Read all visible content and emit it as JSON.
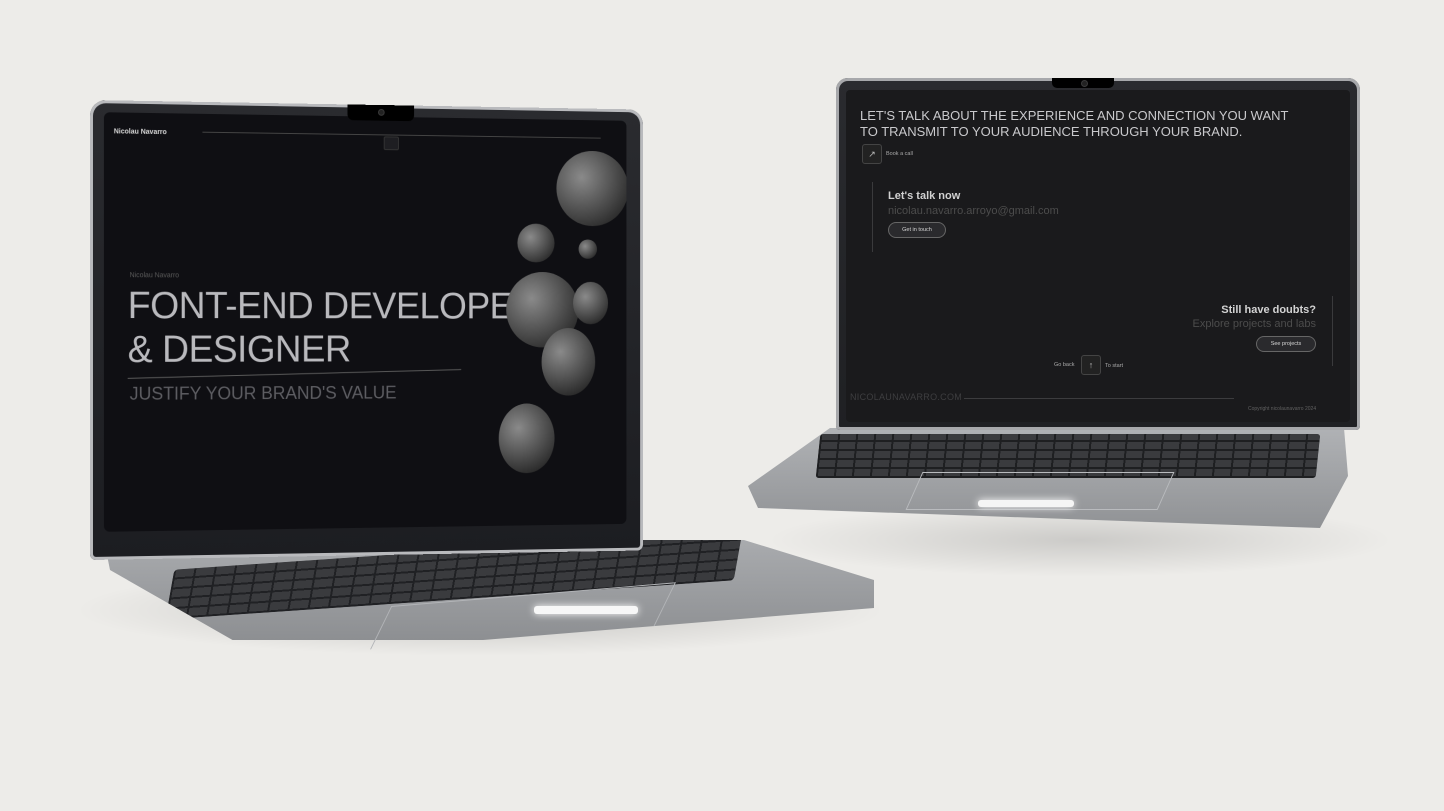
{
  "left_screen": {
    "nav": {
      "brand": "Nicolau Navarro"
    },
    "hero": {
      "eyebrow": "Nicolau Navarro",
      "title": "FONT-END DEVELOPER\n& DESIGNER",
      "subtitle": "JUSTIFY YOUR BRAND'S VALUE"
    }
  },
  "right_screen": {
    "cta": {
      "heading": "LET'S TALK ABOUT THE EXPERIENCE AND CONNECTION YOU WANT TO TRANSMIT TO YOUR AUDIENCE THROUGH YOUR BRAND.",
      "book_icon": "arrow-up-right-icon",
      "book_label": "Book a call"
    },
    "contact": {
      "title": "Let's talk now",
      "email": "nicolau.navarro.arroyo@gmail.com",
      "button": "Get in touch"
    },
    "doubts": {
      "title": "Still have doubts?",
      "subtitle": "Explore projects and labs",
      "button": "See projects"
    },
    "nav_bottom": {
      "back_label": "Go back",
      "start_icon": "arrow-up-icon",
      "start_label": "To start"
    },
    "footer": {
      "brand": "NICOLAUNAVARRO.COM",
      "copyright": "Copyright nicolaunavarro 2024"
    }
  },
  "colors": {
    "background": "#edece9",
    "screen_dark": "#0f0f13",
    "screen_dark_2": "#1a1a1c",
    "laptop_silver": "#a9abae"
  }
}
